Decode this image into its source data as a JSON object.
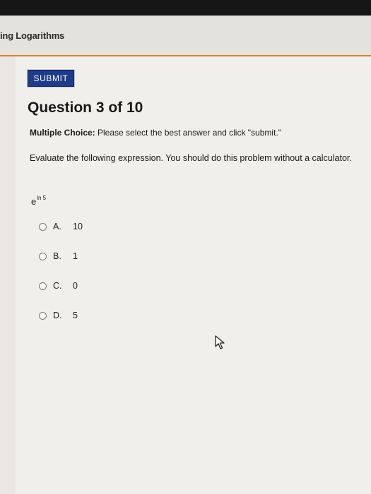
{
  "header": {
    "course_title": "ing Logarithms"
  },
  "toolbar": {
    "submit_label": "SUBMIT"
  },
  "question": {
    "title": "Question 3 of 10",
    "instructions_lead": "Multiple Choice:",
    "instructions_text": "Please select the best answer and click \"submit.\"",
    "prompt": "Evaluate the following expression. You should do this problem without a calculator.",
    "expression_base": "e",
    "expression_exponent": "ln 5"
  },
  "options": [
    {
      "letter": "A.",
      "value": "10"
    },
    {
      "letter": "B.",
      "value": "1"
    },
    {
      "letter": "C.",
      "value": "0"
    },
    {
      "letter": "D.",
      "value": "5"
    }
  ],
  "colors": {
    "submit_bg": "#1f3b8a",
    "accent_line": "#d9862a",
    "top_bar": "#161616"
  }
}
